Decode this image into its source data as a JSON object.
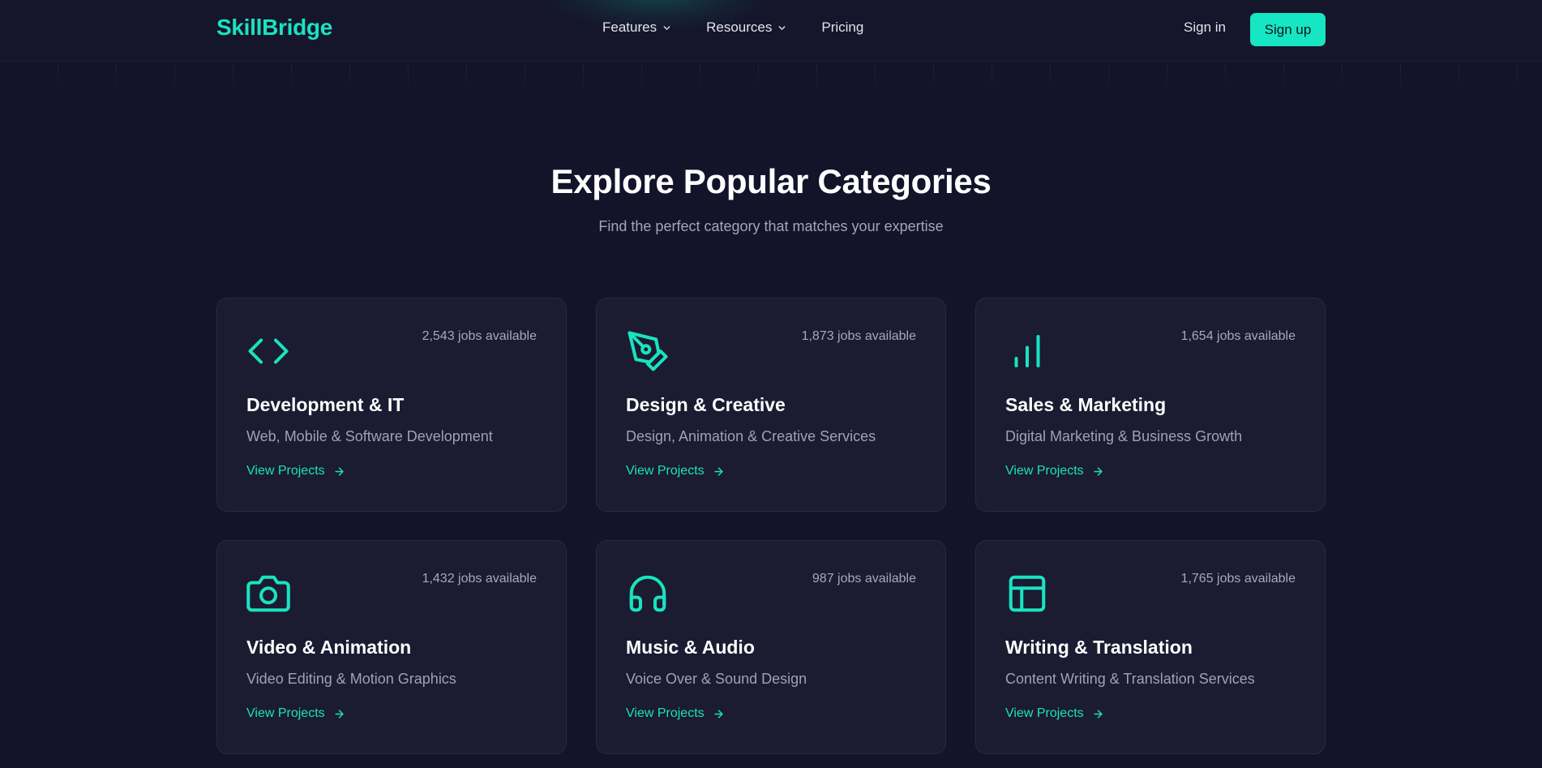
{
  "header": {
    "logo": "SkillBridge",
    "nav": [
      {
        "label": "Features",
        "has_dropdown": true
      },
      {
        "label": "Resources",
        "has_dropdown": true
      },
      {
        "label": "Pricing",
        "has_dropdown": false
      }
    ],
    "sign_in": "Sign in",
    "sign_up": "Sign up"
  },
  "section": {
    "title": "Explore Popular Categories",
    "subtitle": "Find the perfect category that matches your expertise"
  },
  "categories": [
    {
      "icon": "code-icon",
      "jobs": "2,543 jobs available",
      "title": "Development & IT",
      "description": "Web, Mobile & Software Development",
      "link": "View Projects"
    },
    {
      "icon": "pen-tool-icon",
      "jobs": "1,873 jobs available",
      "title": "Design & Creative",
      "description": "Design, Animation & Creative Services",
      "link": "View Projects"
    },
    {
      "icon": "bar-chart-icon",
      "jobs": "1,654 jobs available",
      "title": "Sales & Marketing",
      "description": "Digital Marketing & Business Growth",
      "link": "View Projects"
    },
    {
      "icon": "camera-icon",
      "jobs": "1,432 jobs available",
      "title": "Video & Animation",
      "description": "Video Editing & Motion Graphics",
      "link": "View Projects"
    },
    {
      "icon": "headphones-icon",
      "jobs": "987 jobs available",
      "title": "Music & Audio",
      "description": "Voice Over & Sound Design",
      "link": "View Projects"
    },
    {
      "icon": "layout-icon",
      "jobs": "1,765 jobs available",
      "title": "Writing & Translation",
      "description": "Content Writing & Translation Services",
      "link": "View Projects"
    }
  ],
  "colors": {
    "accent": "#16e6c2",
    "background": "#13132a",
    "card": "#1b1b31",
    "muted_text": "#a3a5b8"
  }
}
